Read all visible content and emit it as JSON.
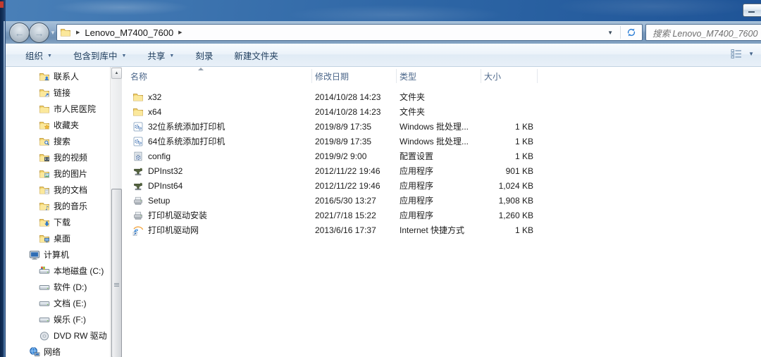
{
  "window": {
    "address_path": "Lenovo_M7400_7600",
    "search_placeholder": "搜索 Lenovo_M7400_7600"
  },
  "icons": {
    "caret_down": "▼",
    "breadcrumb_arrow": "▶",
    "scroll_up_arrow": "▲",
    "back_arrow": "←",
    "forward_arrow": "→"
  },
  "toolbar": {
    "items": [
      {
        "label": "组织",
        "dropdown": true
      },
      {
        "label": "包含到库中",
        "dropdown": true
      },
      {
        "label": "共享",
        "dropdown": true
      },
      {
        "label": "刻录",
        "dropdown": false
      },
      {
        "label": "新建文件夹",
        "dropdown": false
      }
    ]
  },
  "sidebar": {
    "items": [
      {
        "label": "联系人",
        "icon": "folder-contacts",
        "indent": 2
      },
      {
        "label": "链接",
        "icon": "folder-link",
        "indent": 2
      },
      {
        "label": "市人民医院",
        "icon": "folder-plain",
        "indent": 2
      },
      {
        "label": "收藏夹",
        "icon": "folder-star",
        "indent": 2
      },
      {
        "label": "搜索",
        "icon": "folder-search",
        "indent": 2
      },
      {
        "label": "我的视频",
        "icon": "folder-video",
        "indent": 2
      },
      {
        "label": "我的图片",
        "icon": "folder-picture",
        "indent": 2
      },
      {
        "label": "我的文档",
        "icon": "folder-doc",
        "indent": 2
      },
      {
        "label": "我的音乐",
        "icon": "folder-music",
        "indent": 2
      },
      {
        "label": "下载",
        "icon": "folder-download",
        "indent": 2
      },
      {
        "label": "桌面",
        "icon": "folder-desktop",
        "indent": 2
      },
      {
        "label": "计算机",
        "icon": "computer",
        "indent": 1
      },
      {
        "label": "本地磁盘 (C:)",
        "icon": "disk-c",
        "indent": 2
      },
      {
        "label": "软件 (D:)",
        "icon": "disk",
        "indent": 2
      },
      {
        "label": "文档 (E:)",
        "icon": "disk",
        "indent": 2
      },
      {
        "label": "娱乐 (F:)",
        "icon": "disk",
        "indent": 2
      },
      {
        "label": "DVD RW 驱动",
        "icon": "dvd",
        "indent": 2
      },
      {
        "label": "网络",
        "icon": "network",
        "indent": 1
      }
    ]
  },
  "filelist": {
    "columns": [
      "名称",
      "修改日期",
      "类型",
      "大小"
    ],
    "rows": [
      {
        "name": "x32",
        "date": "2014/10/28 14:23",
        "type": "文件夹",
        "size": "",
        "icon": "folder"
      },
      {
        "name": "x64",
        "date": "2014/10/28 14:23",
        "type": "文件夹",
        "size": "",
        "icon": "folder"
      },
      {
        "name": "32位系统添加打印机",
        "date": "2019/8/9 17:35",
        "type": "Windows 批处理...",
        "size": "1 KB",
        "icon": "batch"
      },
      {
        "name": "64位系统添加打印机",
        "date": "2019/8/9 17:35",
        "type": "Windows 批处理...",
        "size": "1 KB",
        "icon": "batch"
      },
      {
        "name": "config",
        "date": "2019/9/2 9:00",
        "type": "配置设置",
        "size": "1 KB",
        "icon": "config"
      },
      {
        "name": "DPInst32",
        "date": "2012/11/22 19:46",
        "type": "应用程序",
        "size": "901 KB",
        "icon": "dpinst"
      },
      {
        "name": "DPInst64",
        "date": "2012/11/22 19:46",
        "type": "应用程序",
        "size": "1,024 KB",
        "icon": "dpinst"
      },
      {
        "name": "Setup",
        "date": "2016/5/30 13:27",
        "type": "应用程序",
        "size": "1,908 KB",
        "icon": "printer"
      },
      {
        "name": "打印机驱动安装",
        "date": "2021/7/18 15:22",
        "type": "应用程序",
        "size": "1,260 KB",
        "icon": "printer"
      },
      {
        "name": "打印机驱动网",
        "date": "2013/6/16 17:37",
        "type": "Internet 快捷方式",
        "size": "1 KB",
        "icon": "ie"
      }
    ]
  }
}
